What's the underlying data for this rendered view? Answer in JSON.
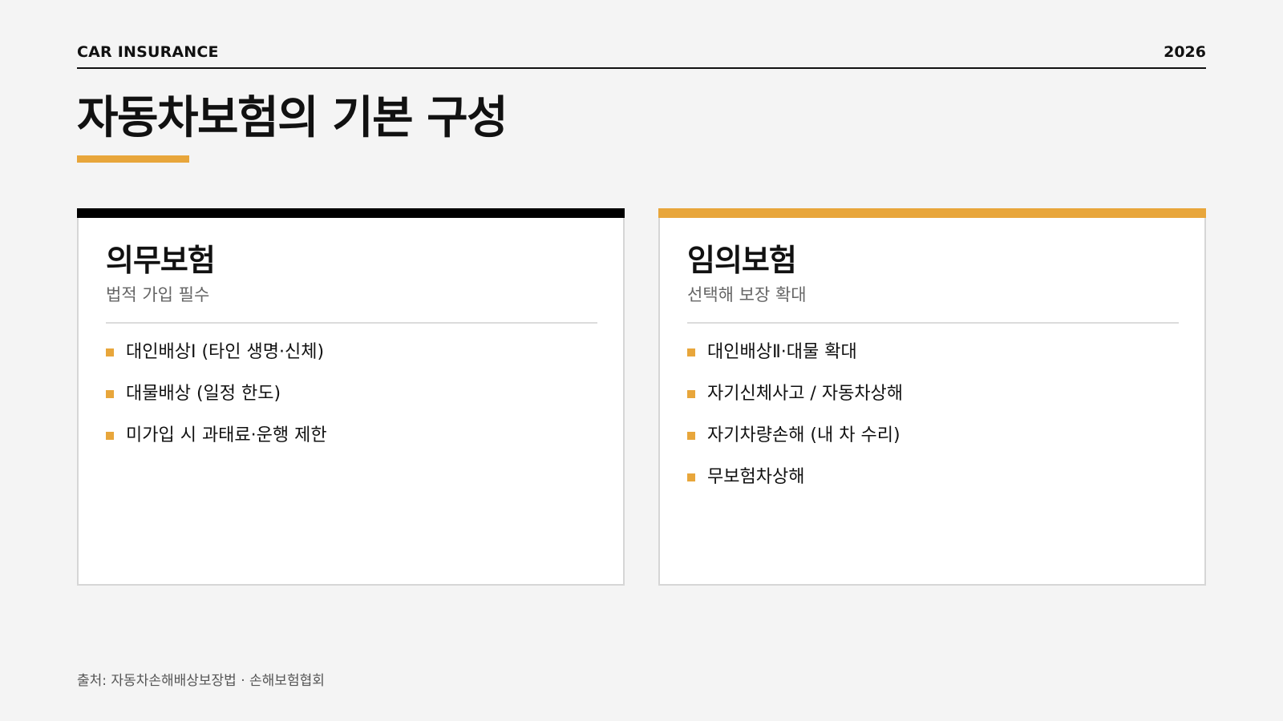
{
  "header": {
    "brand": "CAR INSURANCE",
    "year": "2026"
  },
  "title": "자동차보험의 기본 구성",
  "colors": {
    "accent": "#e8a63b",
    "dark": "#000000"
  },
  "cards": [
    {
      "title": "의무보험",
      "subtitle": "법적 가입 필수",
      "items": [
        "대인배상Ⅰ (타인 생명·신체)",
        "대물배상 (일정 한도)",
        "미가입 시 과태료·운행 제한"
      ]
    },
    {
      "title": "임의보험",
      "subtitle": "선택해 보장 확대",
      "items": [
        "대인배상Ⅱ·대물 확대",
        "자기신체사고 / 자동차상해",
        "자기차량손해 (내 차 수리)",
        "무보험차상해"
      ]
    }
  ],
  "source": "출처: 자동차손해배상보장법 · 손해보험협회"
}
